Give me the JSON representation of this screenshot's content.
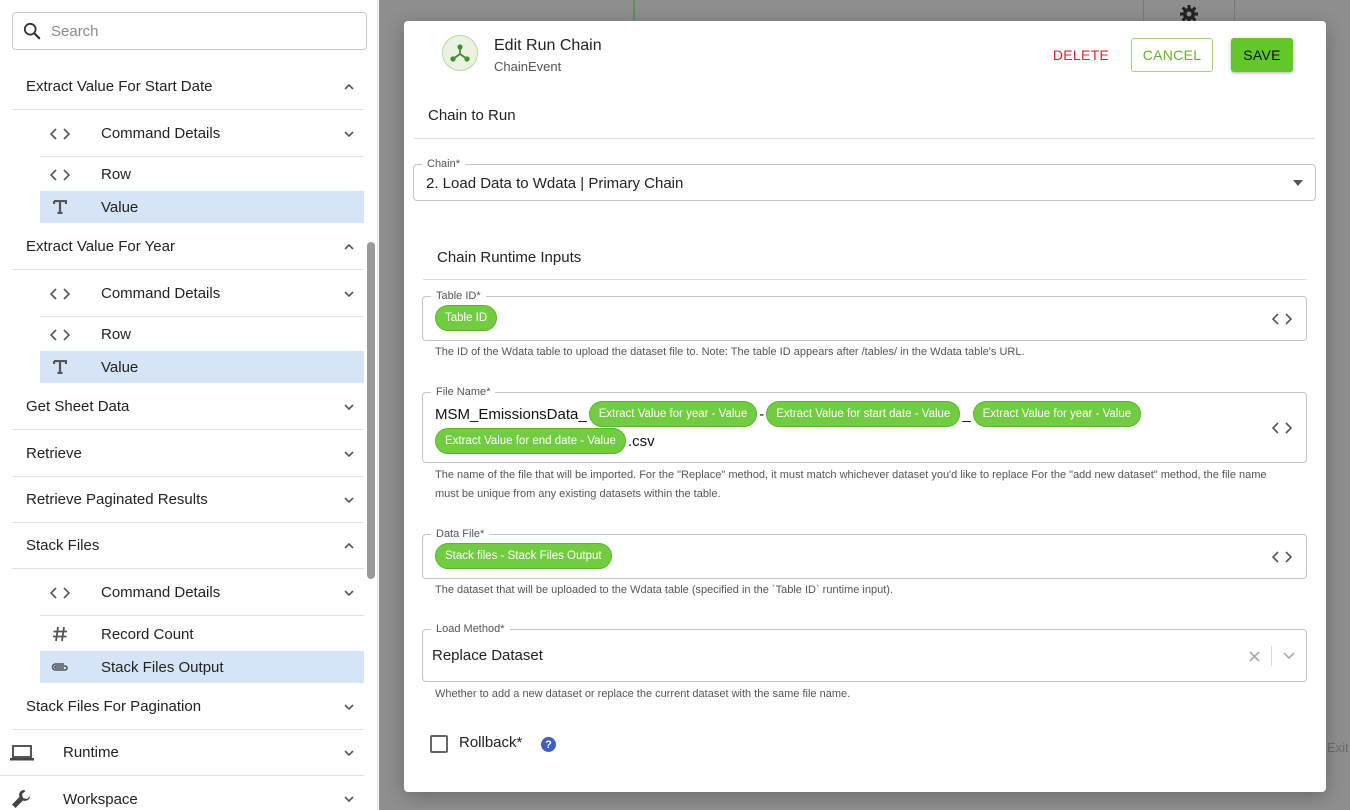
{
  "search": {
    "placeholder": "Search"
  },
  "sidebar": {
    "sections": [
      {
        "label": "Extract Value For Start Date",
        "expanded": true,
        "items": [
          {
            "label": "Command Details",
            "icon": "code-icon",
            "has_chevron": true
          },
          {
            "label": "Row",
            "icon": "code-icon"
          },
          {
            "label": "Value",
            "icon": "text-icon",
            "selected": true
          }
        ]
      },
      {
        "label": "Extract Value For Year",
        "expanded": true,
        "items": [
          {
            "label": "Command Details",
            "icon": "code-icon",
            "has_chevron": true
          },
          {
            "label": "Row",
            "icon": "code-icon"
          },
          {
            "label": "Value",
            "icon": "text-icon",
            "selected": true
          }
        ]
      },
      {
        "label": "Get Sheet Data",
        "expanded": false
      },
      {
        "label": "Retrieve",
        "expanded": false
      },
      {
        "label": "Retrieve Paginated Results",
        "expanded": false
      },
      {
        "label": "Stack Files",
        "expanded": true,
        "items": [
          {
            "label": "Command Details",
            "icon": "code-icon",
            "has_chevron": true
          },
          {
            "label": "Record Count",
            "icon": "hash-icon"
          },
          {
            "label": "Stack Files Output",
            "icon": "paperclip-icon",
            "selected": true
          }
        ]
      },
      {
        "label": "Stack Files For Pagination",
        "expanded": false
      }
    ],
    "bottom": [
      {
        "label": "Runtime",
        "icon": "laptop-icon"
      },
      {
        "label": "Workspace",
        "icon": "wrench-icon"
      }
    ]
  },
  "backdrop": {
    "exit_text": "Exit"
  },
  "modal": {
    "title": "Edit Run Chain",
    "subtitle": "ChainEvent",
    "delete_label": "DELETE",
    "cancel_label": "CANCEL",
    "save_label": "SAVE",
    "chain_section": "Chain to Run",
    "chain_label": "Chain*",
    "chain_value": "2. Load Data to Wdata | Primary Chain",
    "inputs_section": "Chain Runtime Inputs",
    "table_id": {
      "label": "Table ID*",
      "chip": "Table ID",
      "help": "The ID of the Wdata table to upload the dataset file to. Note: The table ID appears after /tables/ in the Wdata table's URL."
    },
    "file_name": {
      "label": "File Name*",
      "prefix": "MSM_EmissionsData_",
      "chip1": "Extract Value for year - Value",
      "sep1": "-",
      "chip2": "Extract Value for start date - Value",
      "sep2": "_",
      "chip3": "Extract Value for year - Value",
      "chip4": "Extract Value for end date - Value",
      "suffix": ".csv",
      "help_line1": "The name of the file that will be imported. For the \"Replace\" method, it must match whichever dataset you'd like to replace For the \"add new dataset\" method, the file name",
      "help_line2": "must be unique from any existing datasets within the table."
    },
    "data_file": {
      "label": "Data File*",
      "chip": "Stack files - Stack Files Output",
      "help": "The dataset that will be uploaded to the Wdata table (specified in the `Table ID` runtime input)."
    },
    "load_method": {
      "label": "Load Method*",
      "value": "Replace Dataset",
      "help": "Whether to add a new dataset or replace the current dataset with the same file name."
    },
    "rollback_label": "Rollback*",
    "rollback_checked": false,
    "help_badge": "?"
  },
  "colors": {
    "accent_green": "#62c72a",
    "chip_green": "#72cc42",
    "delete_red": "#d9262a",
    "selected_row": "#d5e4f7",
    "help_blue": "#3d5fbf"
  }
}
